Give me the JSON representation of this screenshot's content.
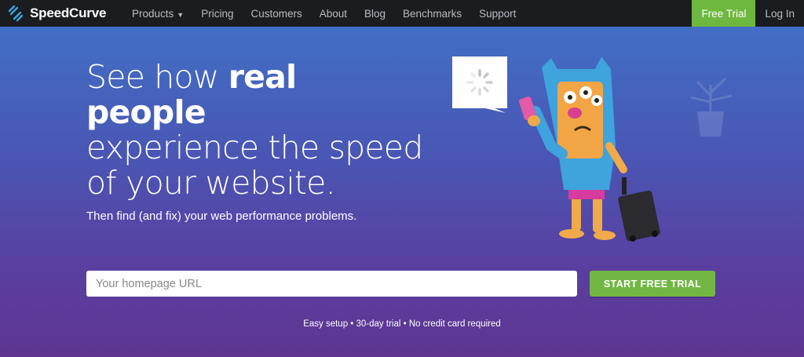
{
  "brand": {
    "name": "SpeedCurve"
  },
  "nav": {
    "items": [
      {
        "label": "Products",
        "has_dropdown": true
      },
      {
        "label": "Pricing"
      },
      {
        "label": "Customers"
      },
      {
        "label": "About"
      },
      {
        "label": "Blog"
      },
      {
        "label": "Benchmarks"
      },
      {
        "label": "Support"
      }
    ],
    "free_trial": "Free Trial",
    "login": "Log In"
  },
  "hero": {
    "headline_part1": "See how ",
    "headline_bold": "real people",
    "headline_part2": "experience the speed of your website.",
    "subhead": "Then find (and fix) your web performance problems.",
    "url_placeholder": "Your homepage URL",
    "cta": "START FREE TRIAL",
    "note": "Easy setup • 30-day trial • No credit card required"
  },
  "colors": {
    "nav_bg": "#1b1c20",
    "accent_green": "#6fb83f",
    "gradient_top": "#3f74c8",
    "gradient_bottom": "#5e3591"
  },
  "icons": [
    "speedcurve-logo-icon",
    "chevron-down-icon",
    "loading-spinner-icon"
  ]
}
